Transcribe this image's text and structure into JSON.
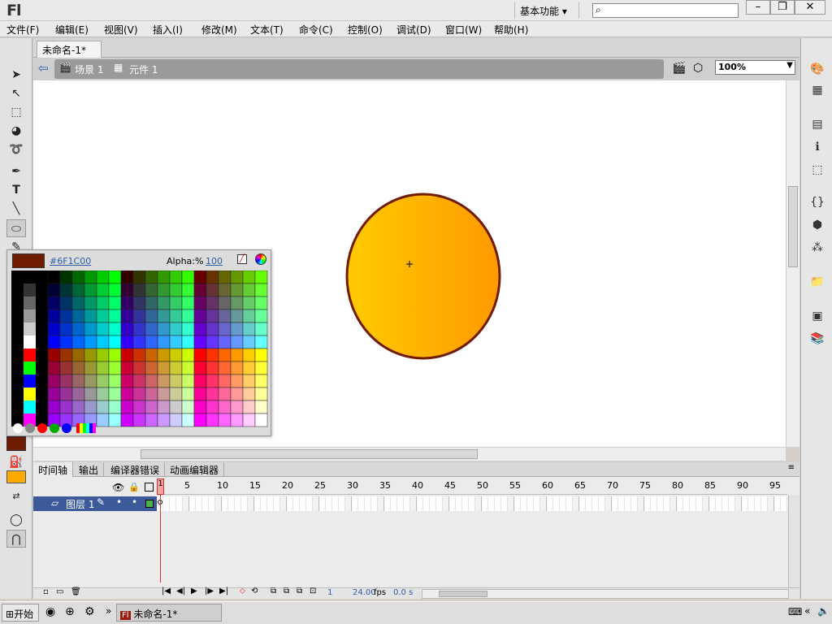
{
  "app": {
    "logo": "Fl",
    "workspace": "基本功能",
    "search_placeholder": ""
  },
  "menu": [
    "文件(F)",
    "编辑(E)",
    "视图(V)",
    "插入(I)",
    "修改(M)",
    "文本(T)",
    "命令(C)",
    "控制(O)",
    "调试(D)",
    "窗口(W)",
    "帮助(H)"
  ],
  "document": {
    "tab_title": "未命名-1*",
    "breadcrumb": [
      "场景 1",
      "元件 1"
    ],
    "zoom": "100%"
  },
  "swatches": {
    "hex": "#6F1C00",
    "alpha_label": "Alpha:%",
    "alpha_value": "100"
  },
  "colors": {
    "stroke": "#6F1C00",
    "fill_start": "#FFCC00",
    "fill_end": "#FF9900"
  },
  "timeline": {
    "tabs": [
      "时间轴",
      "输出",
      "编译器错误",
      "动画编辑器"
    ],
    "layer_name": "图层 1",
    "frame_numbers": [
      "1",
      "5",
      "10",
      "15",
      "20",
      "25",
      "30",
      "35",
      "40",
      "45",
      "50",
      "55",
      "60",
      "65",
      "70",
      "75",
      "80",
      "85",
      "90",
      "95"
    ],
    "current_frame": "1",
    "fps": "24.00",
    "fps_unit": "fps",
    "time": "0.0 s"
  },
  "taskbar": {
    "start": "开始",
    "task": "未命名-1*"
  }
}
